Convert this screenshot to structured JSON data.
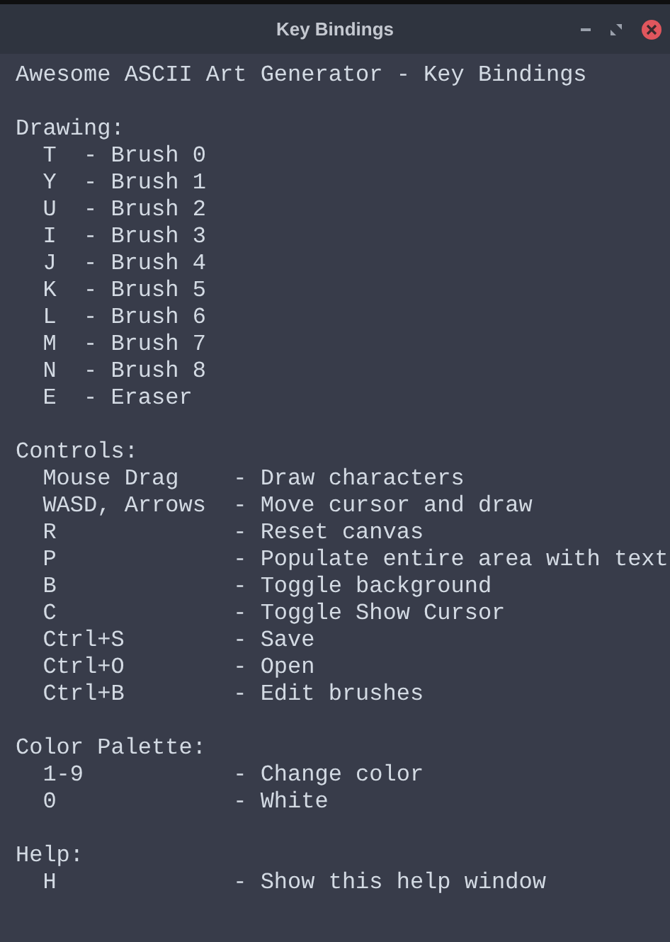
{
  "window": {
    "title": "Key Bindings"
  },
  "heading": "Awesome ASCII Art Generator - Key Bindings",
  "sections": [
    {
      "title": "Drawing:",
      "kind": "compact",
      "bindings": [
        {
          "key": "T",
          "action": "- Brush 0"
        },
        {
          "key": "Y",
          "action": "- Brush 1"
        },
        {
          "key": "U",
          "action": "- Brush 2"
        },
        {
          "key": "I",
          "action": "- Brush 3"
        },
        {
          "key": "J",
          "action": "- Brush 4"
        },
        {
          "key": "K",
          "action": "- Brush 5"
        },
        {
          "key": "L",
          "action": "- Brush 6"
        },
        {
          "key": "M",
          "action": "- Brush 7"
        },
        {
          "key": "N",
          "action": "- Brush 8"
        },
        {
          "key": "E",
          "action": "- Eraser"
        }
      ]
    },
    {
      "title": "Controls:",
      "kind": "aligned",
      "bindings": [
        {
          "key": "Mouse Drag",
          "action": "- Draw characters"
        },
        {
          "key": "WASD, Arrows",
          "action": "- Move cursor and draw"
        },
        {
          "key": "R",
          "action": "- Reset canvas"
        },
        {
          "key": "P",
          "action": "- Populate entire area with text"
        },
        {
          "key": "B",
          "action": "- Toggle background"
        },
        {
          "key": "C",
          "action": "- Toggle Show Cursor"
        },
        {
          "key": "Ctrl+S",
          "action": "- Save"
        },
        {
          "key": "Ctrl+O",
          "action": "- Open"
        },
        {
          "key": "Ctrl+B",
          "action": "- Edit brushes"
        }
      ]
    },
    {
      "title": "Color Palette:",
      "kind": "aligned",
      "bindings": [
        {
          "key": "1-9",
          "action": "- Change color"
        },
        {
          "key": "0",
          "action": "- White"
        }
      ]
    },
    {
      "title": "Help:",
      "kind": "aligned",
      "bindings": [
        {
          "key": "H",
          "action": "- Show this help window"
        }
      ]
    }
  ]
}
